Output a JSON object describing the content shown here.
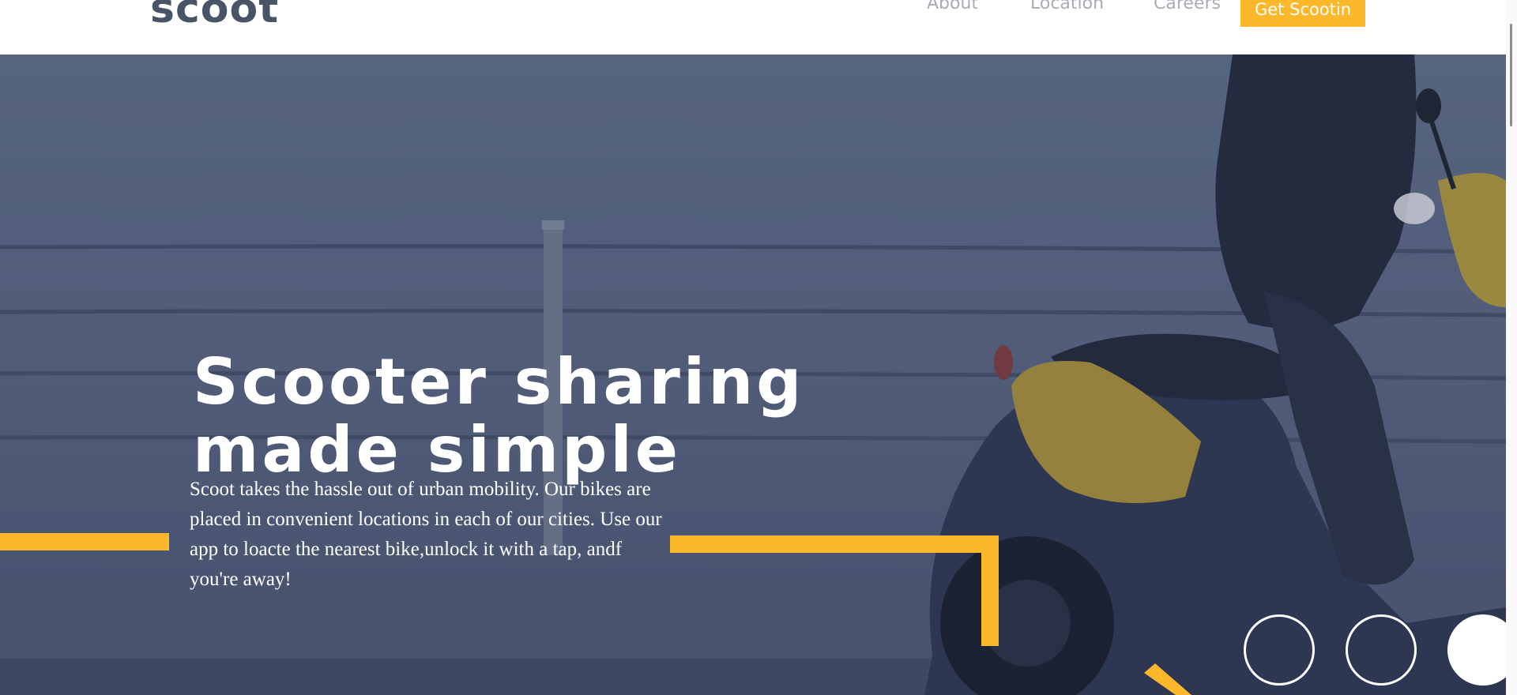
{
  "header": {
    "logo_text": "scoot",
    "nav": {
      "about": "About",
      "location": "Location",
      "careers": "Careers"
    },
    "cta_label": "Get Scootin"
  },
  "hero": {
    "heading_line_1": "Scooter sharing",
    "heading_line_2": "made simple",
    "description": "Scoot takes the hassle out of urban mobility. Our bikes are placed in convenient locations in each of our cities. Use our app to loacte the nearest bike,unlock it with a tap, andf you're away!"
  },
  "colors": {
    "accent": "#fcb72b",
    "logo": "#495567",
    "nav_text": "#a9acb5",
    "hero_overlay": "#4f5b77"
  },
  "icons": {
    "slider_dots": [
      "slider-dot",
      "slider-dot",
      "slider-dot-active"
    ]
  }
}
